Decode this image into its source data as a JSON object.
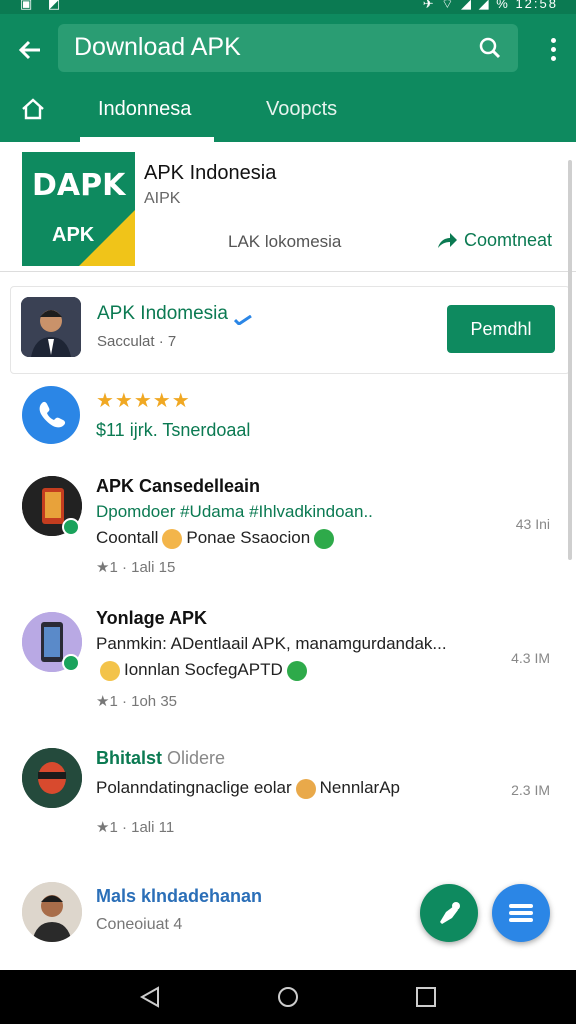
{
  "status_bar": {
    "time": "12:58",
    "left_icons": "▣ ◩",
    "right_icons": "✈ ⌔ ◢ ◢ %"
  },
  "app_bar": {
    "search_value": "Download APK",
    "tabs": [
      {
        "label": "Indonnesa",
        "active": true
      },
      {
        "label": "Voopcts",
        "active": false
      }
    ]
  },
  "header_card": {
    "logo_text_top": "DAPK",
    "logo_text_bottom": "APK",
    "title": "APK Indonesia",
    "subtitle": "AIPK",
    "middle_text": "LAK lokomesia",
    "cta_label": "Coomtneat"
  },
  "featured": {
    "name": "APK Indomesia",
    "subtitle": "Sacculat · 7",
    "button_label": "Pemdhl"
  },
  "rating_item": {
    "stars": "★★★★★",
    "text": "$11 ijrk. Tsnerdoaal"
  },
  "list_items": [
    {
      "title": "APK Cansedelleain",
      "line1": "Dpomdoer #Udama #Ihlvadkindoan..",
      "line2_prefix": "Coontall",
      "line2_suffix": "Ponae Ssaocion",
      "meta": "★1 · 1ali  15",
      "size": "43 Ini"
    },
    {
      "title": "Yonlage APK",
      "line1": "Panmkin: ADentlaail APK, manamgurdandak...",
      "line2_prefix": "",
      "line2_suffix": "Ionnlan SocfegAPTD",
      "meta": "★1 · 1oh  35",
      "size": "4.3 IM"
    },
    {
      "title": "Bhitalst",
      "title_suffix": "Olidere",
      "line1": "Polanndatingnaclige eolar",
      "line1_suffix": "NennlarAp",
      "meta": "★1 · 1ali  11",
      "size": "2.3 IM"
    },
    {
      "title": "Mals klndadehanan",
      "line1": "Coneoiuat  4"
    }
  ],
  "colors": {
    "brand": "#0e8a5f",
    "brand_dark": "#0b7a52",
    "blue": "#2b86e6",
    "star": "#f0a823"
  }
}
